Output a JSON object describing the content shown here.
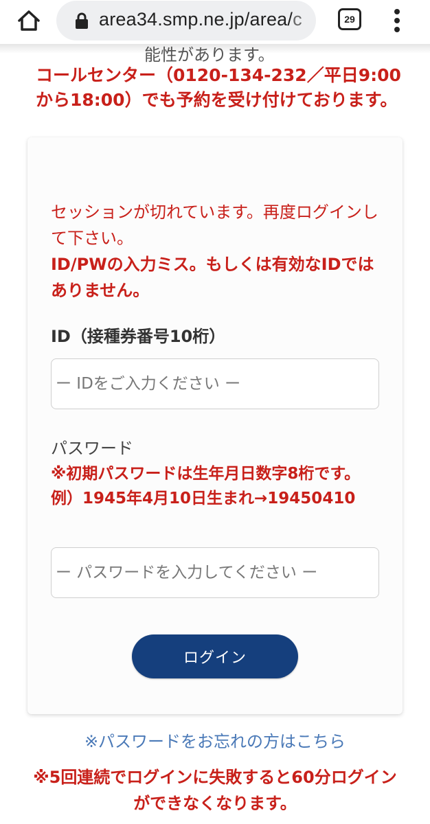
{
  "browser": {
    "url_main": "area34.smp.ne.jp/area/",
    "url_fade": "c",
    "tab_count": "29"
  },
  "page": {
    "partial_line": "能性があります。",
    "notice": "コールセンター（0120-134-232／平日9:00から18:00）でも予約を受け付けております。",
    "error_line1": "セッションが切れています。再度ログインして下さい。",
    "error_line2": "ID/PWの入力ミス。もしくは有効なIDではありません。",
    "id_label": "ID（接種券番号10桁）",
    "id_placeholder": "ー IDをご入力ください ー",
    "pw_label": "パスワード",
    "pw_note1": "※初期パスワードは生年月日数字8桁です。",
    "pw_note2": "例）1945年4月10日生まれ→19450410",
    "pw_placeholder": "ー パスワードを入力してください ー",
    "login_button": "ログイン",
    "forgot_link": "※パスワードをお忘れの方はこちら",
    "warning": "※5回連続でログインに失敗すると60分ログインができなくなります。"
  },
  "colors": {
    "alert_red": "#c8201a",
    "button_navy": "#153f7d",
    "link_blue": "#4a79b7"
  }
}
